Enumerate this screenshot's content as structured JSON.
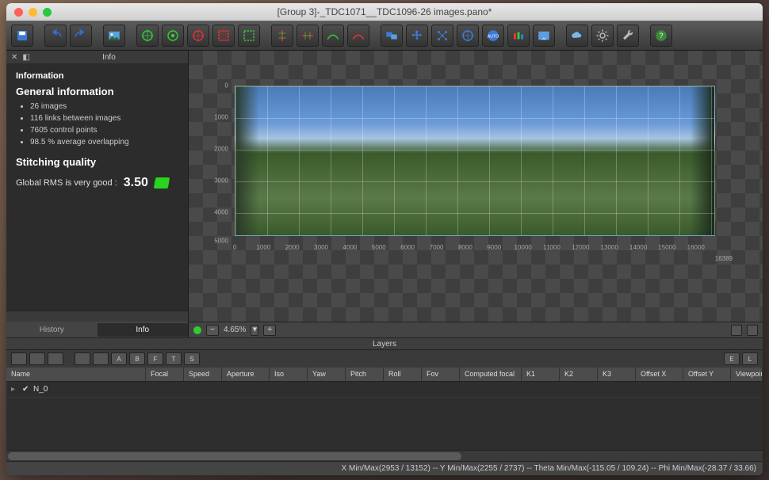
{
  "window_title": "[Group 3]-_TDC1071__TDC1096-26 images.pano*",
  "info_panel": {
    "header": "Info",
    "section_title": "Information",
    "gen_title": "General information",
    "bullets": [
      "26 images",
      "116 links between images",
      "7605 control points",
      "98.5 % average overlapping"
    ],
    "quality_title": "Stitching quality",
    "rms_label": "Global RMS is very good :",
    "rms_value": "3.50",
    "tabs": [
      "History",
      "Info"
    ],
    "active_tab": 1
  },
  "zoom": {
    "value": "4.65%"
  },
  "ruler_y": [
    "0",
    "1000",
    "2000",
    "3000",
    "4000",
    "5000"
  ],
  "ruler_x": [
    "0",
    "1000",
    "2000",
    "3000",
    "4000",
    "5000",
    "6000",
    "7000",
    "8000",
    "9000",
    "10000",
    "11000",
    "12000",
    "13000",
    "14000",
    "15000",
    "16000"
  ],
  "ruler_x_extra": "16389",
  "layers": {
    "title": "Layers",
    "tool_letters": [
      "A",
      "B",
      "F",
      "T",
      "S"
    ],
    "right_letters": [
      "E",
      "L"
    ],
    "columns": [
      "Name",
      "Focal",
      "Speed",
      "Aperture",
      "Iso",
      "Yaw",
      "Pitch",
      "Roll",
      "Fov",
      "Computed focal",
      "K1",
      "K2",
      "K3",
      "Offset X",
      "Offset Y",
      "Viewpoint c"
    ],
    "rows": [
      {
        "name": "N_0",
        "checked": true
      }
    ]
  },
  "status_bar": "X Min/Max(2953 / 13152)   --   Y Min/Max(2255 / 2737)   --   Theta Min/Max(-115.05 / 109.24)   --   Phi Min/Max(-28.37 / 33.66)",
  "chart_data": {
    "type": "table",
    "note": "panorama preview with pixel rulers",
    "x_range": [
      0,
      16389
    ],
    "y_range": [
      0,
      5000
    ]
  }
}
